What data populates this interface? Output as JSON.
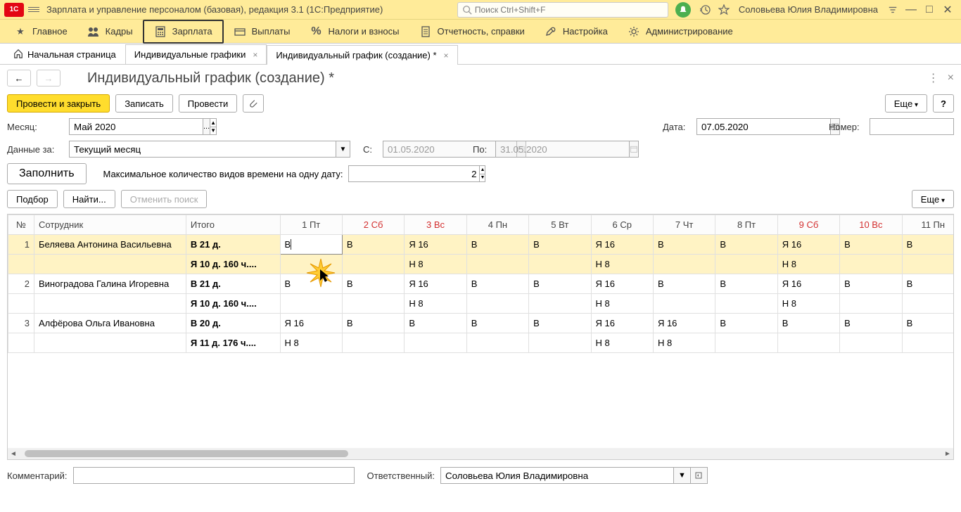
{
  "app": {
    "title": "Зарплата и управление персоналом (базовая), редакция 3.1  (1С:Предприятие)",
    "search_placeholder": "Поиск Ctrl+Shift+F",
    "user": "Соловьева Юлия Владимировна"
  },
  "main_menu": {
    "home": "Главное",
    "staff": "Кадры",
    "salary": "Зарплата",
    "payments": "Выплаты",
    "taxes": "Налоги и взносы",
    "reports": "Отчетность, справки",
    "settings": "Настройка",
    "admin": "Администрирование"
  },
  "tabs": {
    "home": "Начальная страница",
    "t1": "Индивидуальные графики",
    "t2": "Индивидуальный график (создание) *"
  },
  "page": {
    "title": "Индивидуальный график (создание) *",
    "btn_post_close": "Провести и закрыть",
    "btn_save": "Записать",
    "btn_post": "Провести",
    "btn_more": "Еще",
    "btn_help": "?",
    "month_label": "Месяц:",
    "month_value": "Май 2020",
    "date_label": "Дата:",
    "date_value": "07.05.2020",
    "number_label": "Номер:",
    "number_value": "",
    "data_for_label": "Данные за:",
    "data_for_value": "Текущий месяц",
    "from_label": "С:",
    "from_value": "01.05.2020",
    "to_label": "По:",
    "to_value": "31.05.2020",
    "btn_fill": "Заполнить",
    "max_types_label": "Максимальное количество видов времени на одну дату:",
    "max_types_value": "2",
    "btn_pick": "Подбор",
    "btn_find": "Найти...",
    "btn_cancel_search": "Отменить поиск",
    "comment_label": "Комментарий:",
    "comment_value": "",
    "resp_label": "Ответственный:",
    "resp_value": "Соловьева Юлия Владимировна"
  },
  "table": {
    "h_num": "№",
    "h_emp": "Сотрудник",
    "h_total": "Итого",
    "days": [
      {
        "label": "1 Пт",
        "weekend": false
      },
      {
        "label": "2 Сб",
        "weekend": true
      },
      {
        "label": "3 Вс",
        "weekend": true
      },
      {
        "label": "4 Пн",
        "weekend": false
      },
      {
        "label": "5 Вт",
        "weekend": false
      },
      {
        "label": "6 Ср",
        "weekend": false
      },
      {
        "label": "7 Чт",
        "weekend": false
      },
      {
        "label": "8 Пт",
        "weekend": false
      },
      {
        "label": "9 Сб",
        "weekend": true
      },
      {
        "label": "10 Вс",
        "weekend": true
      },
      {
        "label": "11 Пн",
        "weekend": false
      }
    ],
    "rows": [
      {
        "num": "1",
        "emp": "Беляева Антонина Васильевна",
        "total1": "В 21 д.",
        "total2": "Я 10 д. 160 ч....",
        "line1": [
          "В",
          "В",
          "Я 16",
          "В",
          "В",
          "Я 16",
          "В",
          "В",
          "Я 16",
          "В",
          "В"
        ],
        "line2": [
          "",
          "",
          "Н 8",
          "",
          "",
          "Н 8",
          "",
          "",
          "Н 8",
          "",
          ""
        ],
        "selected": true,
        "editing": 0
      },
      {
        "num": "2",
        "emp": "Виноградова Галина Игоревна",
        "total1": "В 21 д.",
        "total2": "Я 10 д. 160 ч....",
        "line1": [
          "В",
          "В",
          "Я 16",
          "В",
          "В",
          "Я 16",
          "В",
          "В",
          "Я 16",
          "В",
          "В"
        ],
        "line2": [
          "",
          "",
          "Н 8",
          "",
          "",
          "Н 8",
          "",
          "",
          "Н 8",
          "",
          ""
        ],
        "selected": false
      },
      {
        "num": "3",
        "emp": "Алфёрова Ольга Ивановна",
        "total1": "В 20 д.",
        "total2": "Я 11 д. 176 ч....",
        "line1": [
          "Я 16",
          "В",
          "В",
          "В",
          "В",
          "Я 16",
          "Я 16",
          "В",
          "В",
          "В",
          "В"
        ],
        "line2": [
          "Н 8",
          "",
          "",
          "",
          "",
          "Н 8",
          "Н 8",
          "",
          "",
          "",
          ""
        ],
        "selected": false
      }
    ]
  }
}
